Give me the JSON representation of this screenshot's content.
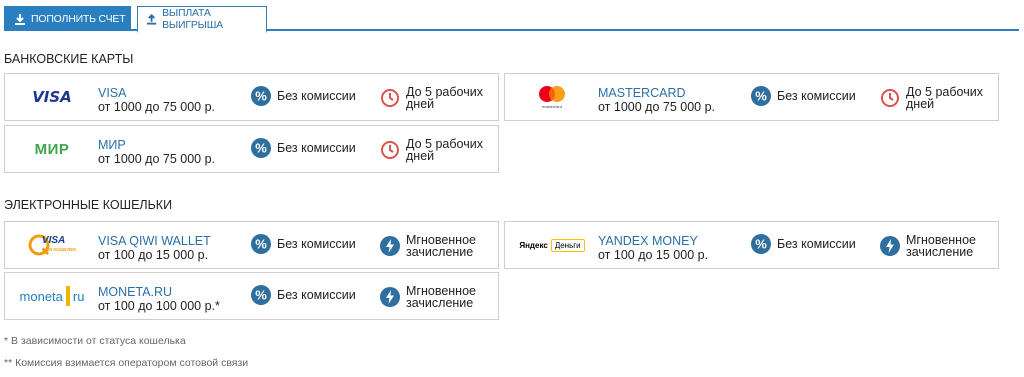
{
  "tabs": {
    "deposit": "Пополнить счет",
    "withdraw": "Выплата выигрыша"
  },
  "sections": {
    "bank_cards": "Банковские карты",
    "e_wallets": "Электронные кошельки"
  },
  "cards": [
    {
      "logo_text": "VISA",
      "name": "VISA",
      "range": "от 1000 до 75 000 р.",
      "commission": "Без комиссии",
      "timing": "До 5 рабочих дней"
    },
    {
      "logo_text": "mastercard",
      "name": "MASTERCARD",
      "range": "от 1000 до 75 000 р.",
      "commission": "Без комиссии",
      "timing": "До 5 рабочих дней"
    },
    {
      "logo_text": "МИР",
      "name": "МИР",
      "range": "от 1000 до 75 000 р.",
      "commission": "Без комиссии",
      "timing": "До 5 рабочих дней"
    }
  ],
  "wallets": [
    {
      "logo_text": "VISA",
      "logo_sub": "QIWI КОШЕЛЕК",
      "name": "VISA QIWI WALLET",
      "range": "от 100 до 15 000 р.",
      "commission": "Без комиссии",
      "timing": "Мгновенное зачисление"
    },
    {
      "logo_text": "Яндекс",
      "logo_sub": "Деньги",
      "name": "YANDEX MONEY",
      "range": "от 100 до 15 000 р.",
      "commission": "Без комиссии",
      "timing": "Мгновенное зачисление"
    },
    {
      "logo_text": "moneta",
      "logo_sub": "ru",
      "name": "MONETA.RU",
      "range": "от 100 до 100 000 р.*",
      "commission": "Без комиссии",
      "timing": "Мгновенное зачисление"
    }
  ],
  "notes": {
    "note1": "* В зависимости от статуса кошелька",
    "note2": "** Комиссия взимается оператором сотовой связи"
  },
  "colors": {
    "accent": "#2a7fc0",
    "percent_icon": "#2f6f9f",
    "clock_icon": "#d9534f",
    "mir_green": "#3fa64a",
    "visa_blue": "#1a3b8a",
    "qiwi_orange": "#f39c12"
  },
  "icons": {
    "commission": "percent-icon",
    "bank_timing": "clock-icon",
    "instant_timing": "lightning-icon",
    "deposit_tab": "download-icon",
    "withdraw_tab": "upload-icon"
  }
}
